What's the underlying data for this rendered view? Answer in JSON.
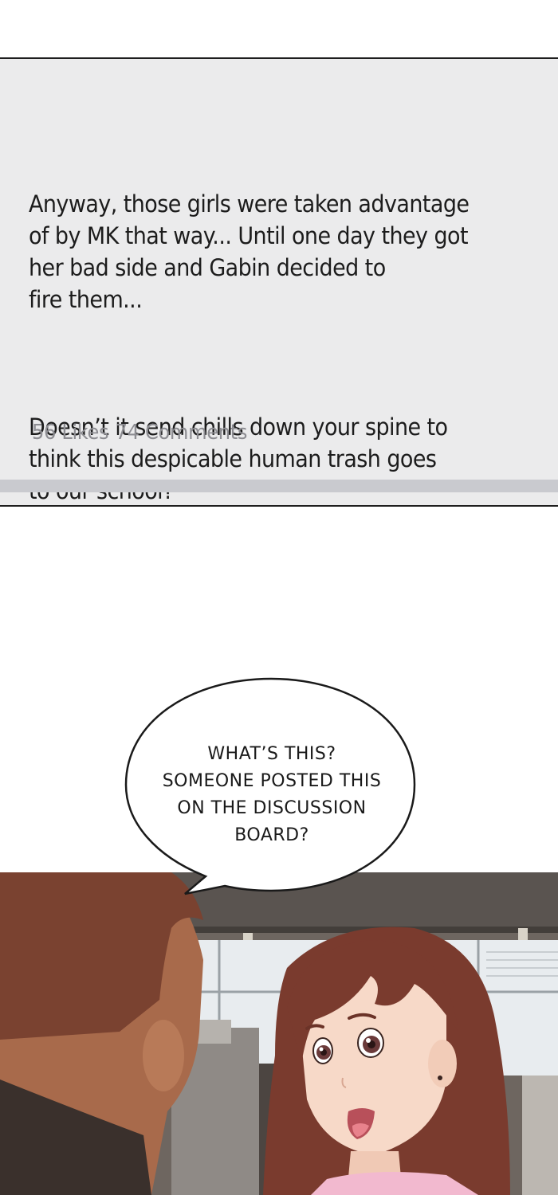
{
  "post": {
    "paragraphs": [
      "Anyway, those girls were taken advantage\nof by MK that way... Until one day they got\nher bad side and Gabin decided to\nfire them...",
      "Doesn’t it send chills down your spine to\nthink this despicable human trash goes\nto our school?"
    ],
    "likes": "56 Likes",
    "comments": "74 Comments"
  },
  "speech_bubble": {
    "lines": [
      "WHAT’S THIS?",
      "SOMEONE POSTED THIS",
      "ON THE DISCUSSION",
      "BOARD?"
    ]
  },
  "colors": {
    "panel_bg": "#ebebec",
    "divider": "#c9cacf",
    "stats_text": "#8d8d92",
    "hair": "#7a3b2e",
    "skin": "#f7d9c8",
    "shirt": "#f2b9cf"
  }
}
